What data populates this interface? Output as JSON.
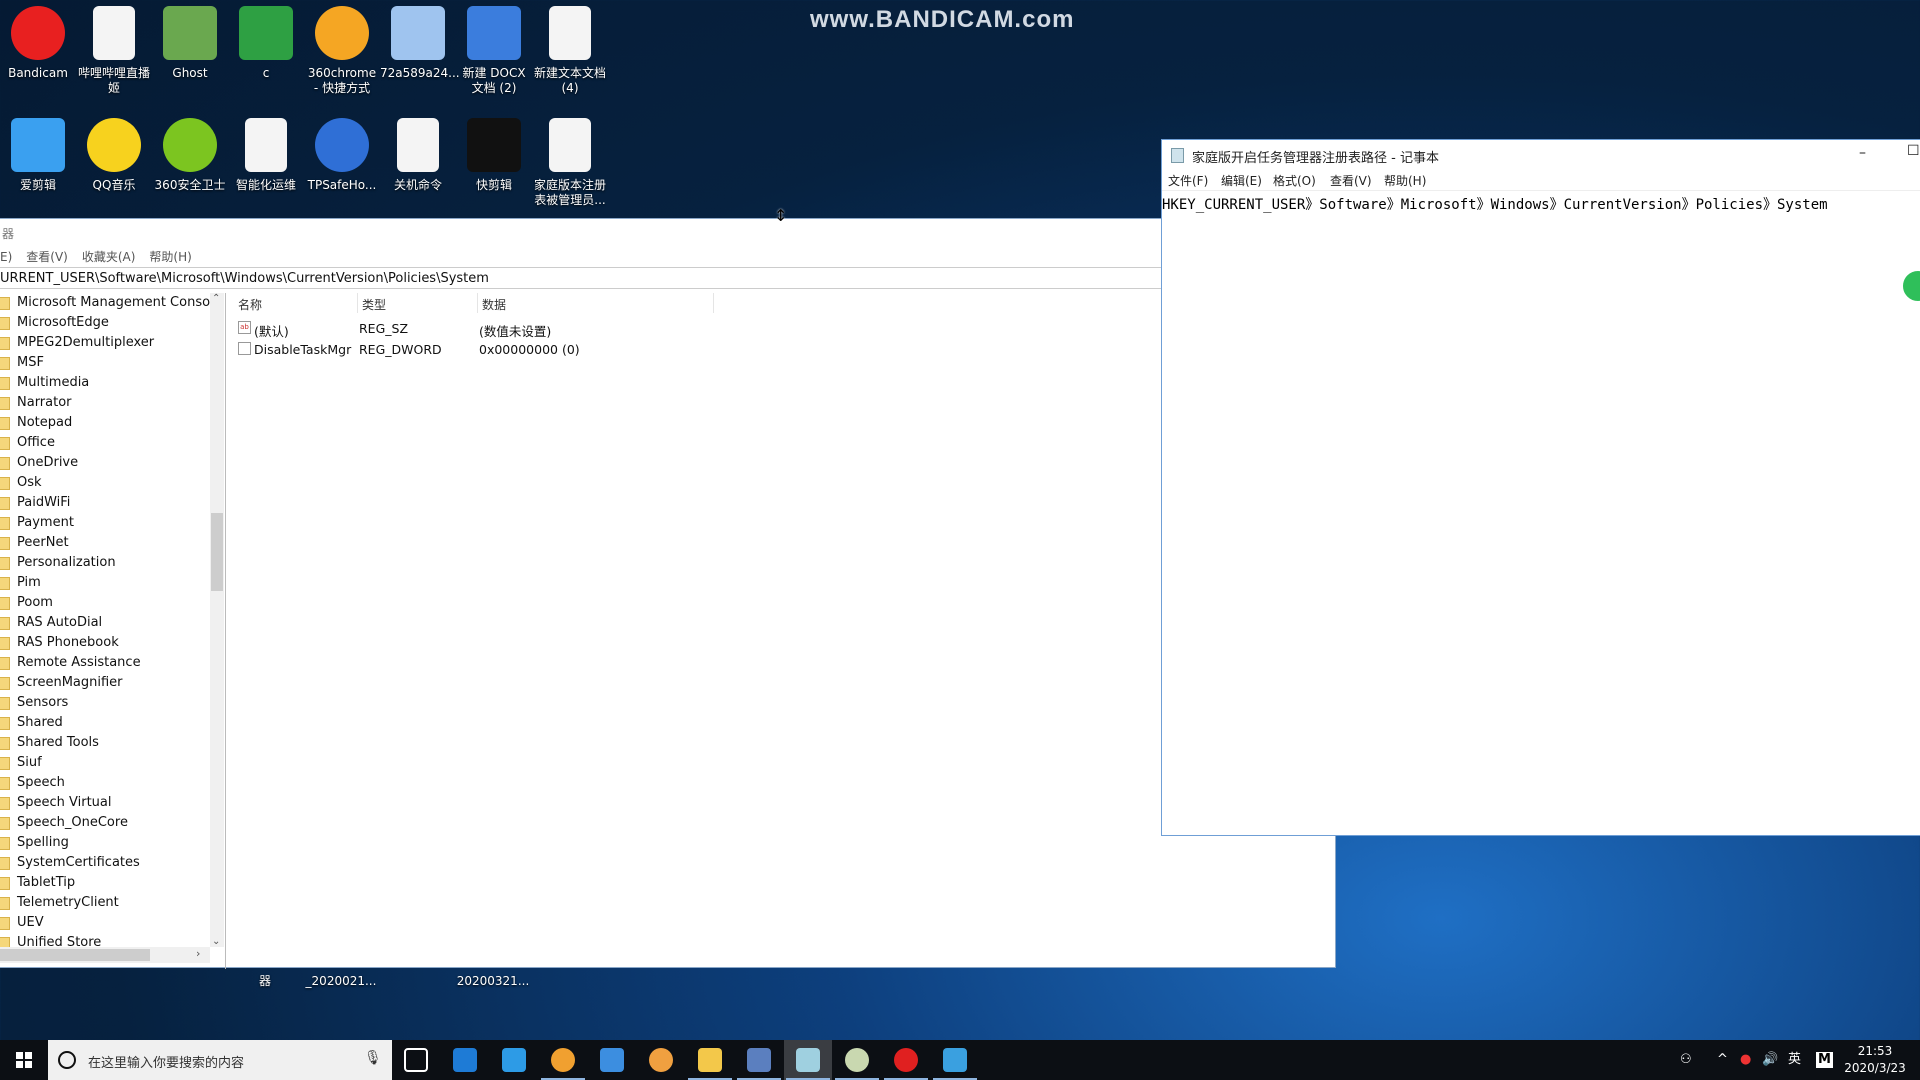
{
  "watermark": "www.BANDICAM.com",
  "desktop_icons": [
    {
      "label": "Bandicam",
      "icon": "bandicam-icon",
      "color": "#e82020"
    },
    {
      "label": "哔哩哔哩直播姬",
      "icon": "file-icon",
      "color": "#f4f4f4"
    },
    {
      "label": "Ghost",
      "icon": "ghost-icon",
      "color": "#6aa84f"
    },
    {
      "label": "c",
      "icon": "spreadsheet-icon",
      "color": "#2ea043"
    },
    {
      "label": "360chrome - 快捷方式",
      "icon": "360chrome-icon",
      "color": "#f5a623"
    },
    {
      "label": "72a589a24...",
      "icon": "image-file-icon",
      "color": "#9fc4ef"
    },
    {
      "label": "新建 DOCX 文档 (2)",
      "icon": "word-doc-icon",
      "color": "#3b7ddd"
    },
    {
      "label": "新建文本文档 (4)",
      "icon": "text-file-icon",
      "color": "#f4f4f4"
    },
    {
      "label": "爱剪辑",
      "icon": "aijianji-icon",
      "color": "#3aa0f0"
    },
    {
      "label": "QQ音乐",
      "icon": "qq-music-icon",
      "color": "#f7d21e"
    },
    {
      "label": "360安全卫士",
      "icon": "360-security-icon",
      "color": "#7cc520"
    },
    {
      "label": "智能化运维",
      "icon": "text-file-icon",
      "color": "#f4f4f4"
    },
    {
      "label": "TPSafeHo...",
      "icon": "tpsafehome-icon",
      "color": "#2f6fd6"
    },
    {
      "label": "关机命令",
      "icon": "text-file-icon",
      "color": "#f4f4f4"
    },
    {
      "label": "快剪辑",
      "icon": "kuaijianji-icon",
      "color": "#111111"
    },
    {
      "label": "家庭版本注册表被管理员...",
      "icon": "text-file-icon",
      "color": "#f4f4f4"
    }
  ],
  "desktop_partial_labels": [
    "器",
    "_2020021...",
    "20200321..."
  ],
  "regedit": {
    "title": "器",
    "menu": [
      "E)",
      "查看(V)",
      "收藏夹(A)",
      "帮助(H)"
    ],
    "address": "URRENT_USER\\Software\\Microsoft\\Windows\\CurrentVersion\\Policies\\System",
    "tree": [
      "Microsoft Management Console",
      "MicrosoftEdge",
      "MPEG2Demultiplexer",
      "MSF",
      "Multimedia",
      "Narrator",
      "Notepad",
      "Office",
      "OneDrive",
      "Osk",
      "PaidWiFi",
      "Payment",
      "PeerNet",
      "Personalization",
      "Pim",
      "Poom",
      "RAS AutoDial",
      "RAS Phonebook",
      "Remote Assistance",
      "ScreenMagnifier",
      "Sensors",
      "Shared",
      "Shared Tools",
      "Siuf",
      "Speech",
      "Speech Virtual",
      "Speech_OneCore",
      "Spelling",
      "SystemCertificates",
      "TabletTip",
      "TelemetryClient",
      "UEV",
      "Unified Store"
    ],
    "columns": [
      "名称",
      "类型",
      "数据"
    ],
    "values": [
      {
        "name": "(默认)",
        "type": "REG_SZ",
        "data": "(数值未设置)",
        "icon": "string-value-icon"
      },
      {
        "name": "DisableTaskMgr",
        "type": "REG_DWORD",
        "data": "0x00000000 (0)",
        "icon": "binary-value-icon"
      }
    ]
  },
  "notepad": {
    "title": "家庭版开启任务管理器注册表路径 - 记事本",
    "menu": [
      "文件(F)",
      "编辑(E)",
      "格式(O)",
      "查看(V)",
      "帮助(H)"
    ],
    "text": "HKEY_CURRENT_USER》Software》Microsoft》Windows》CurrentVersion》Policies》System",
    "minimize": "–",
    "maximize": "☐"
  },
  "taskbar": {
    "search_placeholder": "在这里输入你要搜索的内容",
    "apps": [
      {
        "icon": "task-view-icon",
        "color": "#ffffff"
      },
      {
        "icon": "edge-icon",
        "color": "#1e7bd6"
      },
      {
        "icon": "mail-icon",
        "color": "#2d9be6"
      },
      {
        "icon": "360chrome-icon",
        "color": "#f0a030"
      },
      {
        "icon": "app-window-icon",
        "color": "#3c8ee0"
      },
      {
        "icon": "media-player-icon",
        "color": "#f0a040"
      },
      {
        "icon": "file-explorer-icon",
        "color": "#f3c84a"
      },
      {
        "icon": "network-tool-icon",
        "color": "#5b7fbf"
      },
      {
        "icon": "notepad-icon",
        "color": "#9fd0e0"
      },
      {
        "icon": "avatar-app-icon",
        "color": "#c9d8b0"
      },
      {
        "icon": "bandicam-icon",
        "color": "#e02020"
      },
      {
        "icon": "registry-icon",
        "color": "#3aa0e0"
      }
    ],
    "tray": {
      "lang": "英",
      "ime": "M",
      "time": "21:53",
      "date": "2020/3/23"
    }
  }
}
